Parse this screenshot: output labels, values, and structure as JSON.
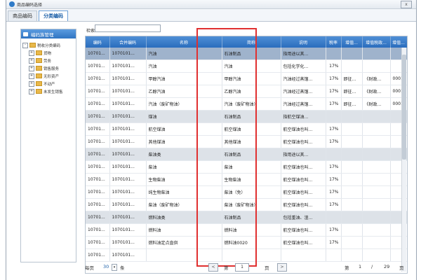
{
  "window": {
    "title": "商品编码选择",
    "close_label": "x"
  },
  "tabs": [
    {
      "label": "商品编码"
    },
    {
      "label": "分类编码"
    }
  ],
  "left_panel": {
    "header": "编码族管理",
    "tree": [
      {
        "label": "税收分类编码",
        "expander": "-",
        "indent": 0
      },
      {
        "label": "货物",
        "expander": "+",
        "indent": 1
      },
      {
        "label": "劳务",
        "expander": "+",
        "indent": 1
      },
      {
        "label": "销售服务",
        "expander": "+",
        "indent": 1
      },
      {
        "label": "无形资产",
        "expander": "+",
        "indent": 1
      },
      {
        "label": "不动产",
        "expander": "+",
        "indent": 1
      },
      {
        "label": "未发生销售",
        "expander": "+",
        "indent": 1
      }
    ]
  },
  "search": {
    "label": "检索",
    "value": ""
  },
  "table": {
    "columns": [
      "编码",
      "合并编码",
      "名称",
      "简称",
      "说明",
      "税率",
      "增值...",
      "增值税政...",
      "增值..."
    ],
    "rows": [
      {
        "type": "selected",
        "cells": [
          "10701...",
          "1070101...",
          "汽油",
          "石油制品",
          "指用途以其...",
          "",
          "",
          "",
          ""
        ]
      },
      {
        "type": "normal",
        "cells": [
          "10701...",
          "1070101...",
          "汽油",
          "汽油",
          "包括化学化...",
          "17%",
          "",
          "",
          ""
        ]
      },
      {
        "type": "normal",
        "cells": [
          "10701...",
          "1070101...",
          "甲醇汽油",
          "甲醇汽油",
          "汽油经过蒸馏...",
          "17%",
          "即征...",
          "《财政...",
          "0001"
        ]
      },
      {
        "type": "normal",
        "cells": [
          "10701...",
          "1070101...",
          "乙醇汽油",
          "乙醇汽油",
          "汽油经过蒸馏...",
          "17%",
          "即征...",
          "《财政...",
          "0001"
        ]
      },
      {
        "type": "normal",
        "cells": [
          "10701...",
          "1070101...",
          "汽油（废矿物油）",
          "汽油（废矿物油）",
          "汽油经过蒸馏...",
          "17%",
          "即征...",
          "《财政...",
          "0001"
        ]
      },
      {
        "type": "group",
        "cells": [
          "10701...",
          "1070101...",
          "煤油",
          "石油制品",
          "指航空煤油...",
          "",
          "",
          "",
          ""
        ]
      },
      {
        "type": "normal",
        "cells": [
          "10701...",
          "1070101...",
          "航空煤油",
          "航空煤油",
          "航空煤油也叫...",
          "17%",
          "",
          "",
          ""
        ]
      },
      {
        "type": "normal",
        "cells": [
          "10701...",
          "1070101...",
          "其他煤油",
          "其他煤油",
          "航空煤油也叫...",
          "17%",
          "",
          "",
          ""
        ]
      },
      {
        "type": "group",
        "cells": [
          "10701...",
          "1070101...",
          "柴油类",
          "石油制品",
          "指用途以其...",
          "",
          "",
          "",
          ""
        ]
      },
      {
        "type": "normal",
        "cells": [
          "10701...",
          "1070101...",
          "柴油",
          "柴油",
          "航空煤油也叫...",
          "17%",
          "",
          "",
          ""
        ]
      },
      {
        "type": "normal",
        "cells": [
          "10701...",
          "1070101...",
          "生物柴油",
          "生物柴油",
          "航空煤油也叫...",
          "17%",
          "",
          "",
          ""
        ]
      },
      {
        "type": "normal",
        "cells": [
          "10701...",
          "1070101...",
          "纯生物柴油",
          "柴油（免）",
          "航空煤油也叫...",
          "17%",
          "",
          "",
          ""
        ]
      },
      {
        "type": "normal",
        "cells": [
          "10701...",
          "1070101...",
          "柴油（废矿物油）",
          "柴油（废矿物油）",
          "航空煤油也叫...",
          "17%",
          "",
          "",
          ""
        ]
      },
      {
        "type": "group",
        "cells": [
          "10701...",
          "1070101...",
          "燃料油类",
          "石油制品",
          "包括重油、渣...",
          "",
          "",
          "",
          ""
        ]
      },
      {
        "type": "normal",
        "cells": [
          "10701...",
          "1070101...",
          "燃料油",
          "燃料油",
          "航空煤油也叫...",
          "17%",
          "",
          "",
          ""
        ]
      },
      {
        "type": "normal",
        "cells": [
          "10701...",
          "1070101...",
          "燃料油定点直供",
          "燃料油0020",
          "航空煤油也叫...",
          "17%",
          "",
          "",
          ""
        ]
      },
      {
        "type": "normal",
        "cells": [
          "10701...",
          "1070101...",
          "",
          "",
          "",
          "",
          "",
          "",
          ""
        ]
      }
    ]
  },
  "footer": {
    "per_page_label": "每页",
    "per_page_value": "30",
    "per_page_unit": "条",
    "first_btn": "<",
    "page_prefix": "第",
    "page_value": "1",
    "page_suffix": "页",
    "next_btn": ">",
    "summary_prefix": "第",
    "summary_current": "1",
    "summary_sep": "/",
    "summary_total": "29",
    "summary_suffix": "页"
  },
  "annotation": {
    "color": "#e03030"
  }
}
